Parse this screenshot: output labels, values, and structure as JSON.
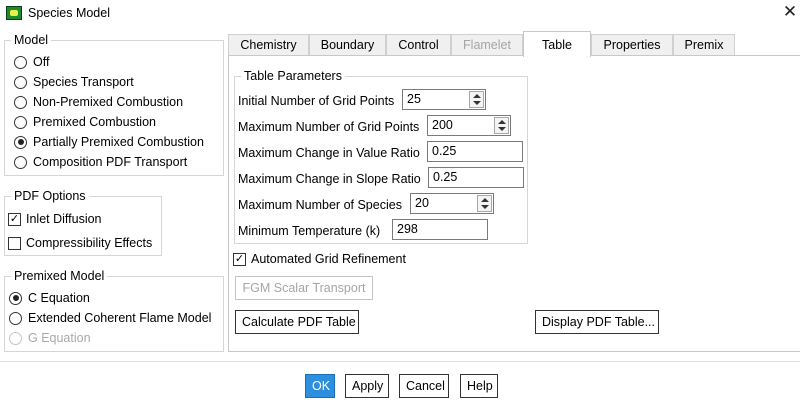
{
  "window": {
    "title": "Species Model",
    "close_glyph": "✕",
    "icon": "app-icon"
  },
  "model": {
    "title": "Model",
    "options": [
      {
        "label": "Off",
        "selected": false
      },
      {
        "label": "Species Transport",
        "selected": false
      },
      {
        "label": "Non-Premixed Combustion",
        "selected": false
      },
      {
        "label": "Premixed Combustion",
        "selected": false
      },
      {
        "label": "Partially Premixed Combustion",
        "selected": true
      },
      {
        "label": "Composition PDF Transport",
        "selected": false
      }
    ]
  },
  "pdf_options": {
    "title": "PDF Options",
    "inlet_diffusion": {
      "label": "Inlet Diffusion",
      "checked": true
    },
    "compressibility": {
      "label": "Compressibility Effects",
      "checked": false
    }
  },
  "premixed_model": {
    "title": "Premixed Model",
    "options": [
      {
        "label": "C Equation",
        "selected": true
      },
      {
        "label": "Extended Coherent Flame Model",
        "selected": false
      },
      {
        "label": "G Equation",
        "selected": false,
        "disabled": true
      }
    ]
  },
  "tabs": [
    {
      "label": "Chemistry",
      "active": false,
      "disabled": false
    },
    {
      "label": "Boundary",
      "active": false,
      "disabled": false
    },
    {
      "label": "Control",
      "active": false,
      "disabled": false
    },
    {
      "label": "Flamelet",
      "active": false,
      "disabled": true
    },
    {
      "label": "Table",
      "active": true,
      "disabled": false
    },
    {
      "label": "Properties",
      "active": false,
      "disabled": false
    },
    {
      "label": "Premix",
      "active": false,
      "disabled": false
    }
  ],
  "table_parameters": {
    "title": "Table Parameters",
    "initial_grid_points": {
      "label": "Initial Number of Grid Points",
      "value": "25"
    },
    "max_grid_points": {
      "label": "Maximum Number of Grid Points",
      "value": "200"
    },
    "max_change_value_ratio": {
      "label": "Maximum Change in Value Ratio",
      "value": "0.25"
    },
    "max_change_slope_ratio": {
      "label": "Maximum Change in Slope Ratio",
      "value": "0.25"
    },
    "max_species": {
      "label": "Maximum Number of Species",
      "value": "20"
    },
    "min_temperature": {
      "label": "Minimum Temperature (k)",
      "value": "298"
    }
  },
  "automated_grid_refinement": {
    "label": "Automated Grid Refinement",
    "checked": true
  },
  "buttons": {
    "fgm_scalar_transport": "FGM Scalar Transport",
    "calculate_pdf_table": "Calculate PDF Table",
    "display_pdf_table": "Display PDF Table...",
    "ok": "OK",
    "apply": "Apply",
    "cancel": "Cancel",
    "help": "Help"
  },
  "colors": {
    "primary_button": "#2e8fde",
    "app_icon": "#1e8a2e"
  }
}
